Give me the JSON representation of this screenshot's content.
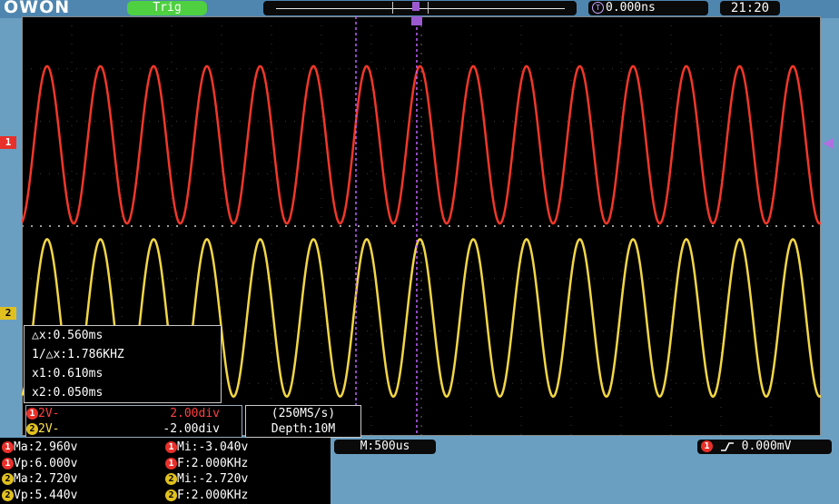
{
  "header": {
    "logo": "OWON",
    "trig_label": "Trig",
    "trigger_time": "0.000ns",
    "clock": "21:20"
  },
  "markers": {
    "ch1": "1",
    "ch2": "2",
    "trig_icon": "T"
  },
  "cursor_measure": {
    "dx": "△x:0.560ms",
    "inv_dx": "1/△x:1.786KHZ",
    "x1": "x1:0.610ms",
    "x2": "x2:0.050ms"
  },
  "channels": [
    {
      "num": "1",
      "label": "2V-",
      "offset": "2.00div",
      "color": "#ff3a2a"
    },
    {
      "num": "2",
      "label": "2V-",
      "offset": "-2.00div",
      "color": "#ffe24a"
    }
  ],
  "acquisition": {
    "rate": "(250MS/s)",
    "depth": "Depth:10M"
  },
  "timebase": "M:500us",
  "trigger_status": {
    "channel": "1",
    "level": "0.000mV"
  },
  "measurements": [
    {
      "ch": "1",
      "text": "Ma:2.960v"
    },
    {
      "ch": "1",
      "text": "Mi:-3.040v"
    },
    {
      "ch": "1",
      "text": "Vp:6.000v"
    },
    {
      "ch": "1",
      "text": "F:2.000KHz"
    },
    {
      "ch": "2",
      "text": "Ma:2.720v"
    },
    {
      "ch": "2",
      "text": "Mi:-2.720v"
    },
    {
      "ch": "2",
      "text": "Vp:5.440v"
    },
    {
      "ch": "2",
      "text": "F:2.000KHz"
    }
  ],
  "waveforms": {
    "ch1_color": "#ff3a2a",
    "ch2_color": "#ffe24a",
    "cycles_on_screen": 15,
    "ch1_amplitude_div": 1.5,
    "ch2_amplitude_div": 1.5
  }
}
